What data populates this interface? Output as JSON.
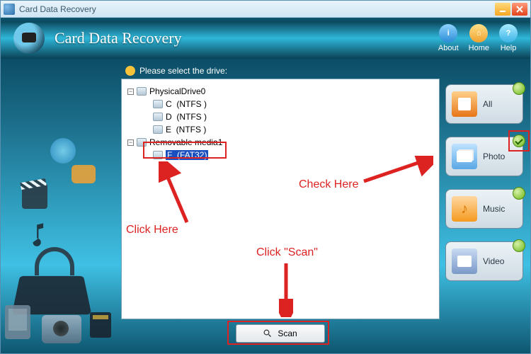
{
  "window": {
    "title": "Card Data Recovery"
  },
  "header": {
    "app_name": "Card Data Recovery",
    "actions": {
      "about": "About",
      "home": "Home",
      "help": "Help"
    }
  },
  "prompt": "Please select the drive:",
  "tree": {
    "root": "PhysicalDrive0",
    "vols": [
      {
        "label": "C  (NTFS )"
      },
      {
        "label": "D  (NTFS )"
      },
      {
        "label": "E  (NTFS )"
      }
    ],
    "removable": "Removable media1",
    "sel": "F  (FAT32)"
  },
  "scan": "Scan",
  "categories": {
    "all": "All",
    "photo": "Photo",
    "music": "Music",
    "video": "Video"
  },
  "annotations": {
    "click_here": "Click Here",
    "check_here": "Check Here",
    "click_scan": "Click \"Scan\""
  }
}
